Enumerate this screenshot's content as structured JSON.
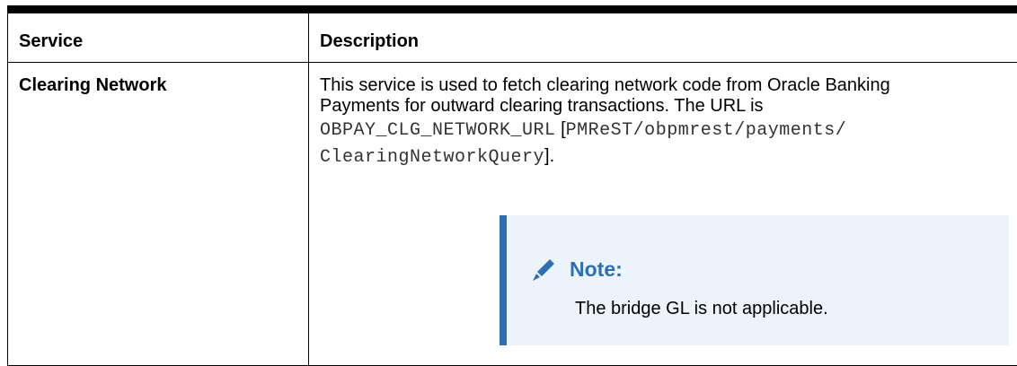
{
  "table": {
    "headers": {
      "service": "Service",
      "description": "Description"
    },
    "rows": [
      {
        "service": "Clearing Network",
        "description_lines": [
          "This service is used to fetch clearing network code from Oracle Banking",
          "Payments for outward clearing transactions. The URL is"
        ],
        "url_var": "OBPAY_CLG_NETWORK_URL",
        "url_path_part1": "PMReST/obpmrest/payments/",
        "url_path_part2": "ClearingNetworkQuery",
        "open_bracket": " [",
        "close_suffix": "].",
        "note": {
          "icon": "pencil-icon",
          "title": "Note:",
          "text": "The bridge GL is not applicable."
        }
      }
    ]
  },
  "colors": {
    "note_accent": "#2e6fb4",
    "note_background": "#edf3fa"
  }
}
